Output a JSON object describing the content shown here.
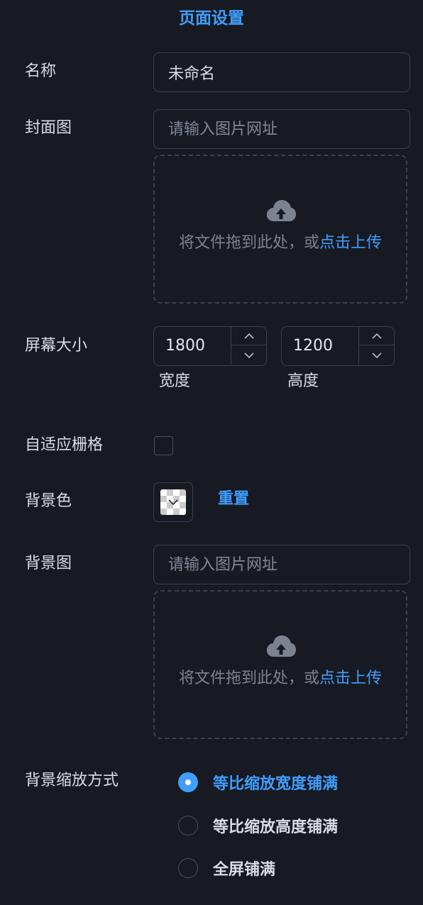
{
  "panel": {
    "title": "页面设置"
  },
  "fields": {
    "name": {
      "label": "名称",
      "value": "未命名"
    },
    "cover": {
      "label": "封面图",
      "placeholder": "请输入图片网址"
    },
    "screen_size": {
      "label": "屏幕大小",
      "width": "1800",
      "width_label": "宽度",
      "height": "1200",
      "height_label": "高度"
    },
    "adaptive_grid": {
      "label": "自适应栅格",
      "checked": false
    },
    "bg_color": {
      "label": "背景色",
      "reset_label": "重置"
    },
    "bg_image": {
      "label": "背景图",
      "placeholder": "请输入图片网址"
    },
    "bg_scale": {
      "label": "背景缩放方式",
      "options": [
        {
          "label": "等比缩放宽度铺满",
          "checked": true
        },
        {
          "label": "等比缩放高度铺满",
          "checked": false
        },
        {
          "label": "全屏铺满",
          "checked": false
        }
      ]
    }
  },
  "upload": {
    "text": "将文件拖到此处，或",
    "link": "点击上传",
    "icon": "upload-cloud-icon"
  },
  "colors": {
    "accent": "#409eff",
    "background": "#171a22",
    "border": "#3a4150"
  }
}
